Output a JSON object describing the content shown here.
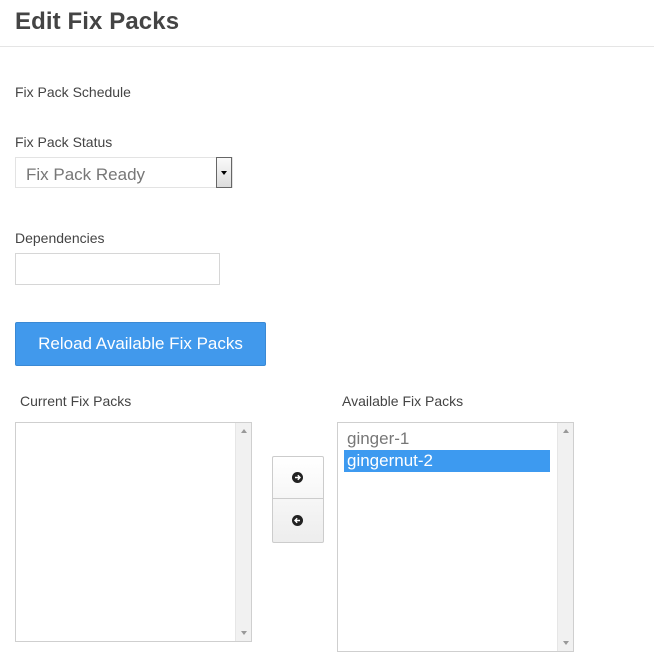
{
  "header": {
    "title": "Edit Fix Packs"
  },
  "form": {
    "schedule_label": "Fix Pack Schedule",
    "status_label": "Fix Pack Status",
    "status_value": "Fix Pack Ready",
    "dependencies_label": "Dependencies",
    "dependencies_value": "",
    "reload_button": "Reload Available Fix Packs"
  },
  "lists": {
    "current_label": "Current Fix Packs",
    "current_items": [],
    "available_label": "Available Fix Packs",
    "available_items": [
      "ginger-1",
      "gingernut-2"
    ],
    "available_selected": "gingernut-2"
  },
  "colors": {
    "primary": "#4199ec",
    "selection": "#3d9af0"
  },
  "icons": {
    "move_right": "arrow-right-circle-icon",
    "move_left": "arrow-left-circle-icon"
  }
}
